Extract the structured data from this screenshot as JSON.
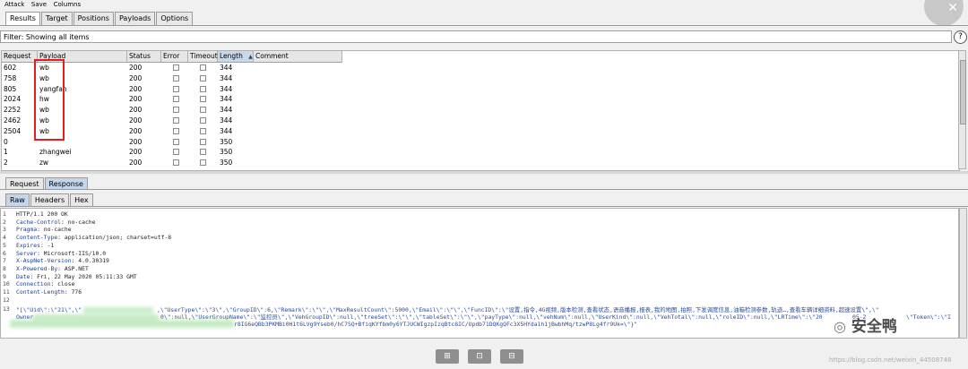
{
  "menu": [
    "Attack",
    "Save",
    "Columns"
  ],
  "tabs": [
    "Results",
    "Target",
    "Positions",
    "Payloads",
    "Options"
  ],
  "filter_text": "Filter: Showing all items",
  "help_label": "?",
  "columns": [
    "Request",
    "Payload",
    "Status",
    "Error",
    "Timeout",
    "Length",
    "Comment"
  ],
  "sort_arrow": "▲",
  "rows": [
    {
      "req": "602",
      "payload": "wb",
      "status": "200",
      "len": "344"
    },
    {
      "req": "758",
      "payload": "wb",
      "status": "200",
      "len": "344"
    },
    {
      "req": "805",
      "payload": "yangfan",
      "status": "200",
      "len": "344"
    },
    {
      "req": "2024",
      "payload": "hw",
      "status": "200",
      "len": "344"
    },
    {
      "req": "2252",
      "payload": "wb",
      "status": "200",
      "len": "344"
    },
    {
      "req": "2462",
      "payload": "wb",
      "status": "200",
      "len": "344"
    },
    {
      "req": "2504",
      "payload": "wb",
      "status": "200",
      "len": "344"
    },
    {
      "req": "0",
      "payload": "",
      "status": "200",
      "len": "350"
    },
    {
      "req": "1",
      "payload": "zhangwei",
      "status": "200",
      "len": "350"
    },
    {
      "req": "2",
      "payload": "zw",
      "status": "200",
      "len": "350"
    }
  ],
  "request_tabs": [
    "Request",
    "Response"
  ],
  "view_tabs": [
    "Raw",
    "Headers",
    "Hex"
  ],
  "response_lines": [
    {
      "n": "1",
      "key": "",
      "val": "HTTP/1.1 200 OK"
    },
    {
      "n": "2",
      "key": "Cache-Control",
      "val": ": no-cache"
    },
    {
      "n": "3",
      "key": "Pragma",
      "val": ": no-cache"
    },
    {
      "n": "4",
      "key": "Content-Type",
      "val": ": application/json; charset=utf-8"
    },
    {
      "n": "5",
      "key": "Expires",
      "val": ": -1"
    },
    {
      "n": "6",
      "key": "Server",
      "val": ": Microsoft-IIS/10.0"
    },
    {
      "n": "7",
      "key": "X-AspNet-Version",
      "val": ": 4.0.30319"
    },
    {
      "n": "8",
      "key": "X-Powered-By",
      "val": ": ASP.NET"
    },
    {
      "n": "9",
      "key": "Date",
      "val": ": Fri, 22 May 2020 05:11:33 GMT"
    },
    {
      "n": "10",
      "key": "Connection",
      "val": ": close"
    },
    {
      "n": "11",
      "key": "Content-Length",
      "val": ": 776"
    },
    {
      "n": "12",
      "key": "",
      "val": ""
    }
  ],
  "json_line_num": "13",
  "json_line_1a": "\"[\\\"Uid\\\":\\\"21\\\",\\\"",
  "json_line_1b": ",\\\"UserType\\\":\\\"3\\\",\\\"GroupID\\\":6,\\\"Remark\\\":\\\"\\\",\\\"MaxResultCount\\\":5000,\\\"Email\\\":\\\"\\\",\\\"FuncID\\\":\\\"设置,指令,4G视频,版本检测,查看状态,语音播报,报表,我的地图,拍照,下发调度信息,油箱检测参数,轨迹…,查看车辆详细资料,超速设置\\\",\\\"",
  "json_line_2a": "Owner",
  "json_line_2b": "0\\\":null,\\\"UserGroupName\\\":\\\"监控员\\\",\\\"VehGroupID\\\":null,\\\"treeSet\\\":\\\"\\\",\\\"tableSet\\\":\\\"\\\",\\\"payType\\\":null,\\\"vehNum\\\":null,\\\"UserKind\\\":null,\\\"VehTotal\\\":null,\\\"roleID\\\":null,\\\"LRTime\\\":\\\"20",
  "json_line_2c": "05-2",
  "json_line_2d": "\\\"Token\\\":\\\"I",
  "json_line_3": "r8IG6eQBb3PKMBi0H1t6LVg9Yseb0/hC7SQ+BfiqKYfbm0y6YTJUCWIgzpIzqBtc8IC/Updb71DQKgQFc3X5HYda1h1jBwbhMq/tzwP8Lg4fr9Uk=\\\"}\"",
  "tool_buttons": [
    "⊞",
    "⊡",
    "⊟"
  ],
  "watermark": "安全鸭",
  "watermark_url": "https://blog.csdn.net/weixin_44508748"
}
